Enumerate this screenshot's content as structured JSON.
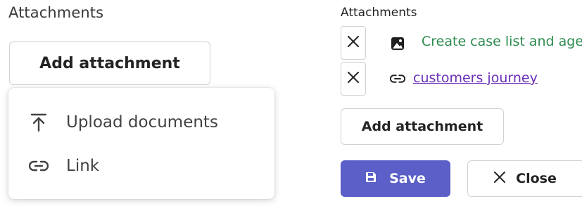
{
  "left_panel": {
    "title": "Attachments",
    "add_button_label": "Add attachment",
    "menu": [
      {
        "label": "Upload documents",
        "icon": "upload-icon"
      },
      {
        "label": "Link",
        "icon": "link-icon"
      }
    ]
  },
  "right_panel": {
    "title": "Attachments",
    "attachments": [
      {
        "label": "Create case list and age",
        "icon": "image-file-icon",
        "color": "#2e8b4f"
      },
      {
        "label": "customers journey",
        "icon": "link-icon",
        "color": "#6a2fb8"
      }
    ],
    "add_button_label": "Add attachment",
    "save_label": "Save",
    "close_label": "Close",
    "accent_color": "#5b5fc7"
  }
}
